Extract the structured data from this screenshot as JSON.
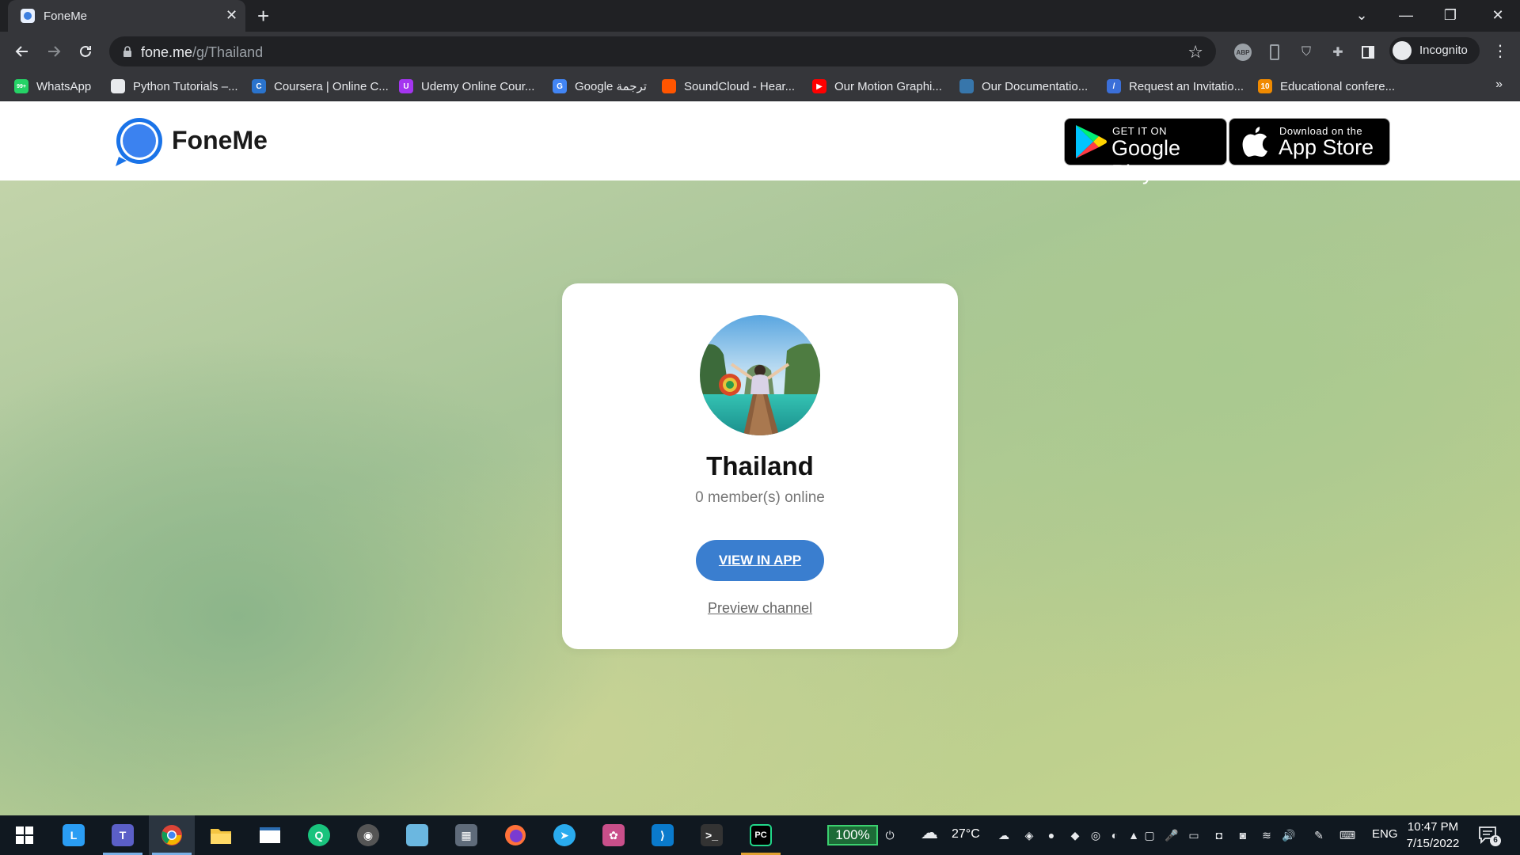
{
  "browser": {
    "tab_title": "FoneMe",
    "tab_close": "✕",
    "new_tab": "+",
    "url_host": "fone.me",
    "url_path": "/g/Thailand",
    "incognito_label": "Incognito",
    "window_controls": {
      "tab_search": "⌄",
      "minimize": "—",
      "restore": "❐",
      "close": "✕"
    }
  },
  "bookmarks": [
    {
      "label": "WhatsApp",
      "icon": "whatsapp-icon",
      "color": "#25d366",
      "glyph": "99+"
    },
    {
      "label": "Python Tutorials –...",
      "icon": "python-icon",
      "color": "#e8eaed",
      "glyph": ""
    },
    {
      "label": "Coursera | Online C...",
      "icon": "coursera-icon",
      "color": "#2a73cc",
      "glyph": "C"
    },
    {
      "label": "Udemy Online Cour...",
      "icon": "udemy-icon",
      "color": "#a435f0",
      "glyph": "U"
    },
    {
      "label": "Google ترجمة",
      "icon": "google-translate-icon",
      "color": "#4285f4",
      "glyph": "G"
    },
    {
      "label": "SoundCloud - Hear...",
      "icon": "soundcloud-icon",
      "color": "#ff5500",
      "glyph": ""
    },
    {
      "label": "Our Motion Graphi...",
      "icon": "youtube-icon",
      "color": "#ff0000",
      "glyph": "▶"
    },
    {
      "label": "Our Documentatio...",
      "icon": "python-logo-icon",
      "color": "#3776ab",
      "glyph": ""
    },
    {
      "label": "Request an Invitatio...",
      "icon": "invitation-icon",
      "color": "#3b6fd8",
      "glyph": "/"
    },
    {
      "label": "Educational confere...",
      "icon": "conference-icon",
      "color": "#f08a00",
      "glyph": "10"
    }
  ],
  "bookmarks_more": "»",
  "site": {
    "brand": "FoneMe",
    "google_play": {
      "small": "GET IT ON",
      "big": "Google Play"
    },
    "app_store": {
      "small": "Download on the",
      "big": "App Store"
    }
  },
  "channel": {
    "title": "Thailand",
    "subtitle": "0 member(s) online",
    "view_button": "VIEW IN APP",
    "preview_link": "Preview channel"
  },
  "taskbar": {
    "battery": "100%",
    "temperature": "27°C",
    "language": "ENG",
    "time": "10:47 PM",
    "date": "7/15/2022",
    "notifications": "6",
    "apps": [
      {
        "name": "start-icon",
        "color": "#ffffff",
        "glyph": ""
      },
      {
        "name": "lexi-icon",
        "color": "#2a9df4",
        "glyph": "L"
      },
      {
        "name": "teams-icon",
        "color": "#5b5fc7",
        "glyph": "T"
      },
      {
        "name": "chrome-icon",
        "color": "#db4437",
        "glyph": ""
      },
      {
        "name": "file-explorer-icon",
        "color": "#f4c542",
        "glyph": ""
      },
      {
        "name": "window-icon",
        "color": "#ffffff",
        "glyph": ""
      },
      {
        "name": "search-app-icon",
        "color": "#19c37d",
        "glyph": "Q"
      },
      {
        "name": "media-icon",
        "color": "#555555",
        "glyph": "◉"
      },
      {
        "name": "notes-icon",
        "color": "#6bb7e0",
        "glyph": ""
      },
      {
        "name": "calculator-icon",
        "color": "#5f6b7a",
        "glyph": "▦"
      },
      {
        "name": "firefox-icon",
        "color": "#ff7139",
        "glyph": ""
      },
      {
        "name": "telegram-icon",
        "color": "#2aabee",
        "glyph": "➤"
      },
      {
        "name": "paint-icon",
        "color": "#c94f8a",
        "glyph": "✿"
      },
      {
        "name": "vscode-icon",
        "color": "#0a7acc",
        "glyph": "⟩"
      },
      {
        "name": "terminal-icon",
        "color": "#333333",
        "glyph": ">_"
      },
      {
        "name": "pycharm-icon",
        "color": "#21d789",
        "glyph": "PC"
      }
    ],
    "tray_icons": [
      "☁",
      "◈",
      "●",
      "◆",
      "◎",
      "◐",
      "▲",
      "▢",
      "🎤",
      "▭",
      "◘",
      "◙",
      "≋",
      "🔊",
      "✎",
      "⌨"
    ]
  }
}
